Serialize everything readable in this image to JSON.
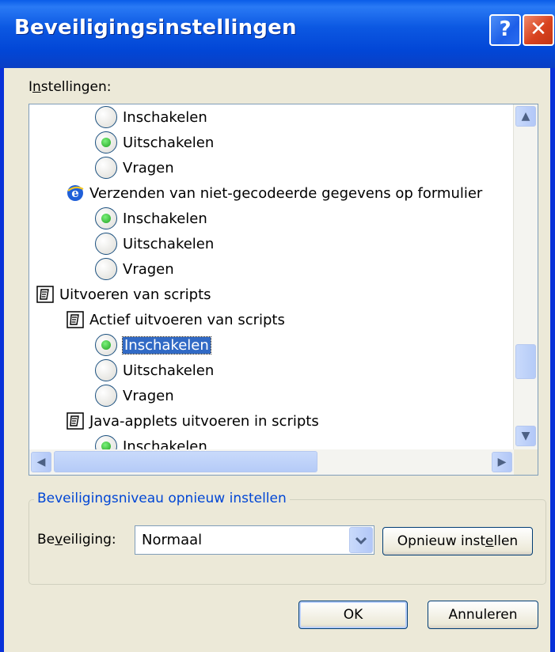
{
  "window": {
    "title": "Beveiligingsinstellingen",
    "help_glyph": "?",
    "close_glyph": "✕"
  },
  "settings_label_prefix": "I",
  "settings_label_underlined": "n",
  "settings_label_suffix": "stellingen:",
  "list": {
    "items": [
      {
        "type": "radio",
        "label": "Inschakelen",
        "checked": false
      },
      {
        "type": "radio",
        "label": "Uitschakelen",
        "checked": true
      },
      {
        "type": "radio",
        "label": "Vragen",
        "checked": false
      },
      {
        "type": "group",
        "icon": "ie-icon",
        "label": "Verzenden van niet-gecodeerde gegevens op formulier"
      },
      {
        "type": "radio",
        "label": "Inschakelen",
        "checked": true
      },
      {
        "type": "radio",
        "label": "Uitschakelen",
        "checked": false
      },
      {
        "type": "radio",
        "label": "Vragen",
        "checked": false
      },
      {
        "type": "category",
        "icon": "script-icon",
        "label": "Uitvoeren van scripts"
      },
      {
        "type": "group",
        "icon": "script-icon",
        "label": "Actief uitvoeren van scripts"
      },
      {
        "type": "radio",
        "label": "Inschakelen",
        "checked": true,
        "selected": true
      },
      {
        "type": "radio",
        "label": "Uitschakelen",
        "checked": false
      },
      {
        "type": "radio",
        "label": "Vragen",
        "checked": false
      },
      {
        "type": "group",
        "icon": "script-icon",
        "label": "Java-applets uitvoeren in scripts"
      },
      {
        "type": "radio",
        "label": "Inschakelen",
        "checked": true
      }
    ]
  },
  "reset_group": {
    "title": "Beveiligingsniveau opnieuw instellen",
    "security_label_prefix": "Be",
    "security_label_underlined": "v",
    "security_label_suffix": "eiliging:",
    "combo_value": "Normaal",
    "reset_button_prefix": "Opnieuw inst",
    "reset_button_underlined": "e",
    "reset_button_suffix": "llen"
  },
  "buttons": {
    "ok": "OK",
    "cancel": "Annuleren"
  },
  "colors": {
    "titlebar": "#0a52e0",
    "face": "#ece9d8",
    "selection": "#316ac5",
    "group_title": "#0046d5"
  }
}
